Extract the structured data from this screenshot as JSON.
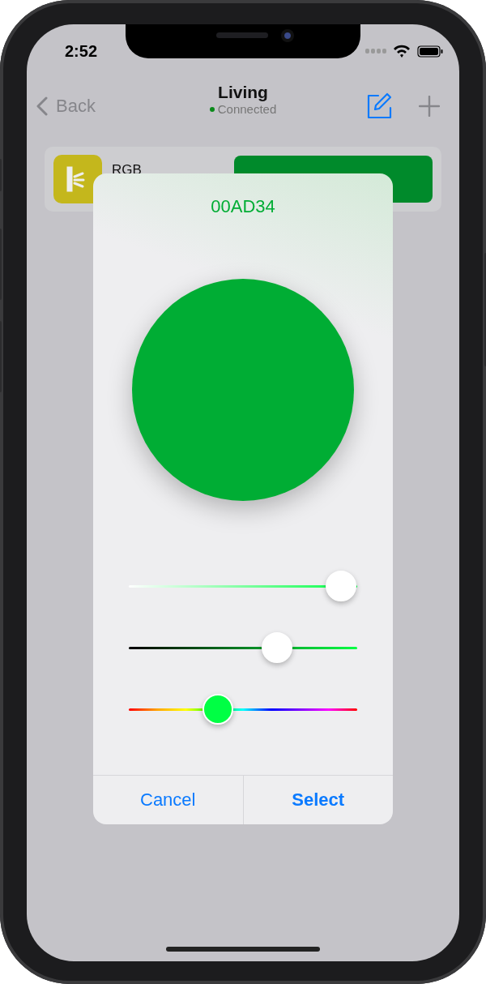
{
  "status_bar": {
    "time": "2:52"
  },
  "nav": {
    "back": "Back",
    "title": "Living",
    "subtitle": "Connected"
  },
  "devices": [
    {
      "name": "RGB"
    }
  ],
  "color_picker": {
    "hex": "00AD34",
    "sliders": [
      {
        "kind": "saturation",
        "level": 0.93
      },
      {
        "kind": "brightness",
        "level": 0.65
      },
      {
        "kind": "hue",
        "level": 0.39
      }
    ],
    "buttons": [
      {
        "label": "Cancel",
        "kind": "cancel"
      },
      {
        "label": "Select",
        "kind": "confirm"
      }
    ]
  }
}
